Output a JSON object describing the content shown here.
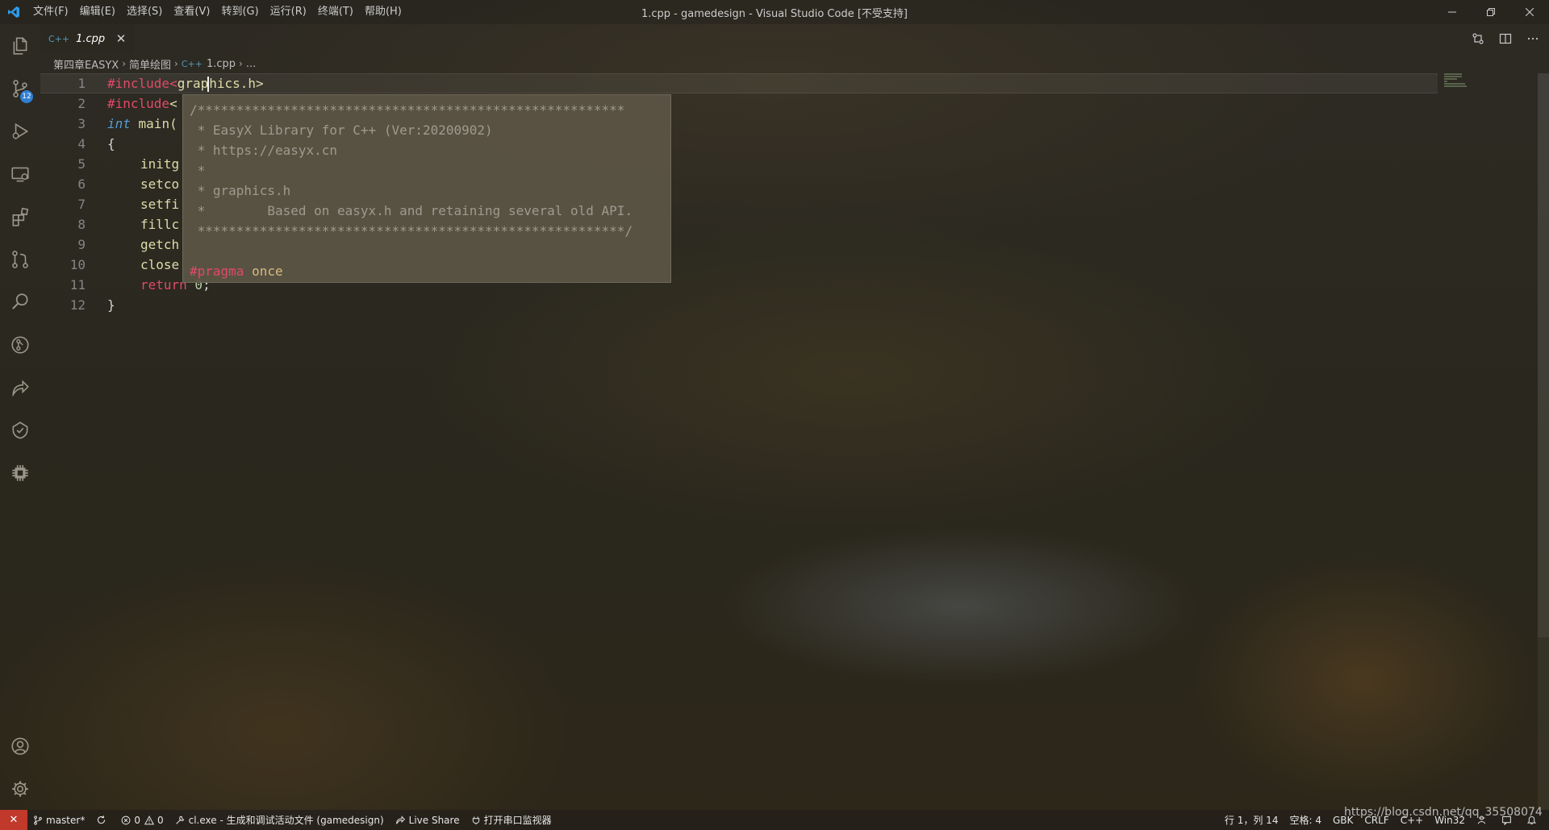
{
  "window": {
    "title": "1.cpp - gamedesign - Visual Studio Code [不受支持]"
  },
  "menu": [
    "文件(F)",
    "编辑(E)",
    "选择(S)",
    "查看(V)",
    "转到(G)",
    "运行(R)",
    "终端(T)",
    "帮助(H)"
  ],
  "activity_bar": {
    "source_control_badge": "12",
    "icons": [
      "explorer-icon",
      "source-control-icon",
      "run-debug-icon",
      "remote-explorer-icon",
      "extensions-icon",
      "git-graph-icon",
      "search-icon",
      "gitlens-icon",
      "live-share-icon",
      "testing-icon",
      "platformio-icon"
    ],
    "bottom_icons": [
      "accounts-icon",
      "settings-gear-icon"
    ]
  },
  "tab": {
    "lang": "C++",
    "label": "1.cpp",
    "close": "✕"
  },
  "breadcrumb": {
    "folder1": "第四章EASYX",
    "folder2": "简单绘图",
    "file_lang": "C++",
    "file": "1.cpp",
    "symbol": "..."
  },
  "code": {
    "line_numbers": [
      "1",
      "2",
      "3",
      "4",
      "5",
      "6",
      "7",
      "8",
      "9",
      "10",
      "11",
      "12"
    ],
    "l1_directive": "#include",
    "l1_open": "<",
    "l1_a": "grap",
    "l1_b": "hics.h",
    "l1_close": ">",
    "l2_directive": "#include",
    "l2_rest": "<",
    "l3_type": "int",
    "l3_rest": " main(",
    "l4": "{",
    "l5": "initg",
    "l6": "setco",
    "l7": "setfi",
    "l8": "fillc",
    "l9": "getch",
    "l10": "close",
    "l11_kw": "return",
    "l11_num": " 0",
    "l11_end": ";",
    "l12": "}"
  },
  "hover": {
    "lines": [
      "/*******************************************************",
      " * EasyX Library for C++ (Ver:20200902)",
      " * https://easyx.cn",
      " *",
      " * graphics.h",
      " *        Based on easyx.h and retaining several old API.",
      " *******************************************************/",
      ""
    ],
    "pragma": "#pragma",
    "once": " once"
  },
  "statusbar": {
    "remote": "✕",
    "branch": "master*",
    "errors": "0",
    "warnings": "0",
    "task": "cl.exe - 生成和调试活动文件 (gamedesign)",
    "live_share": "Live Share",
    "serial": "打开串口监视器",
    "position": "行 1，列 14",
    "spaces": "空格: 4",
    "encoding": "GBK",
    "eol": "CRLF",
    "language": "C++",
    "platform": "Win32"
  },
  "watermark": "https://blog.csdn.net/qq_35508074"
}
